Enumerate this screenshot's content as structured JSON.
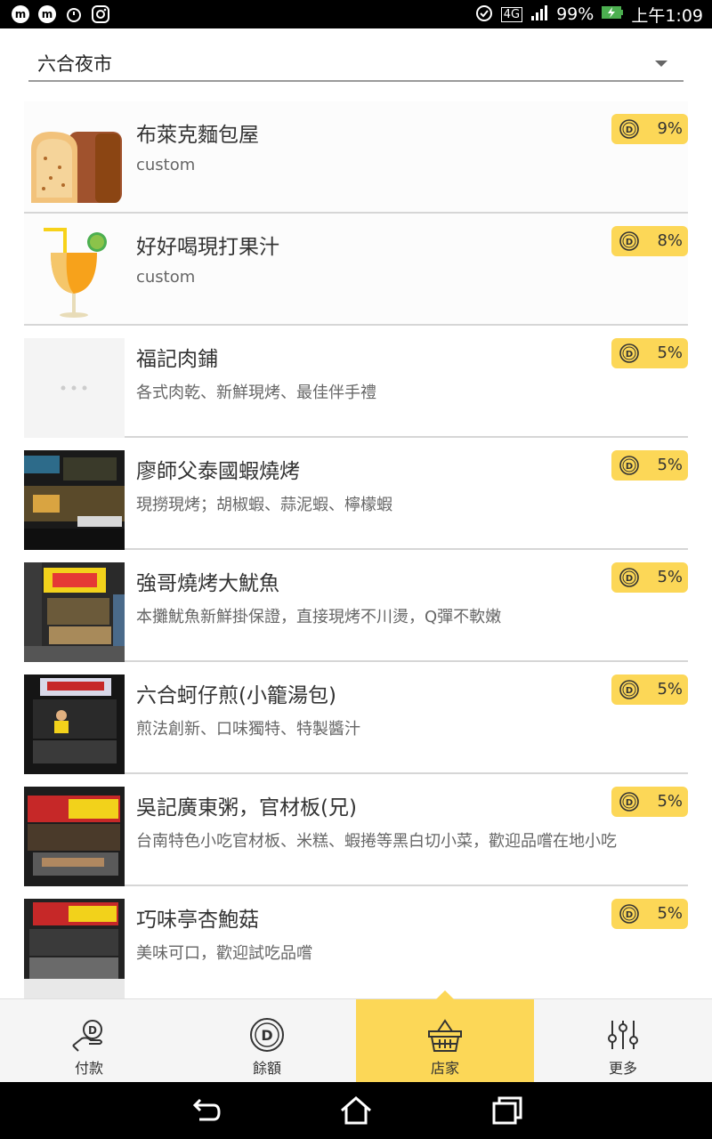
{
  "status_bar": {
    "battery": "99%",
    "network": "4G",
    "time": "上午1:09"
  },
  "dropdown": {
    "selected": "六合夜市"
  },
  "stores": [
    {
      "name": "布萊克麵包屋",
      "desc": "custom",
      "percent": "9%",
      "thumb": "bread-icon"
    },
    {
      "name": "好好喝現打果汁",
      "desc": "custom",
      "percent": "8%",
      "thumb": "juice-icon"
    },
    {
      "name": "福記肉鋪",
      "desc": "各式肉乾、新鮮現烤、最佳伴手禮",
      "percent": "5%",
      "thumb": "placeholder"
    },
    {
      "name": "廖師父泰國蝦燒烤",
      "desc": "現撈現烤；胡椒蝦、蒜泥蝦、檸檬蝦",
      "percent": "5%",
      "thumb": "photo"
    },
    {
      "name": "強哥燒烤大魷魚",
      "desc": "本攤魷魚新鮮掛保證，直接現烤不川燙，Q彈不軟嫩",
      "percent": "5%",
      "thumb": "photo"
    },
    {
      "name": "六合蚵仔煎(小籠湯包)",
      "desc": "煎法創新、口味獨特、特製醬汁",
      "percent": "5%",
      "thumb": "photo"
    },
    {
      "name": "吳記廣東粥，官材板(兄)",
      "desc": "台南特色小吃官材板、米糕、蝦捲等黑白切小菜，歡迎品嚐在地小吃",
      "percent": "5%",
      "thumb": "photo"
    },
    {
      "name": "巧味亭杏鮑菇",
      "desc": "美味可口，歡迎試吃品嚐",
      "percent": "5%",
      "thumb": "photo"
    }
  ],
  "tabs": [
    {
      "label": "付款",
      "icon": "pay-hand-coin-icon"
    },
    {
      "label": "餘額",
      "icon": "coin-icon"
    },
    {
      "label": "店家",
      "icon": "basket-icon"
    },
    {
      "label": "更多",
      "icon": "sliders-icon"
    }
  ],
  "colors": {
    "accent": "#fcd757",
    "divider": "#d6d6d6"
  }
}
